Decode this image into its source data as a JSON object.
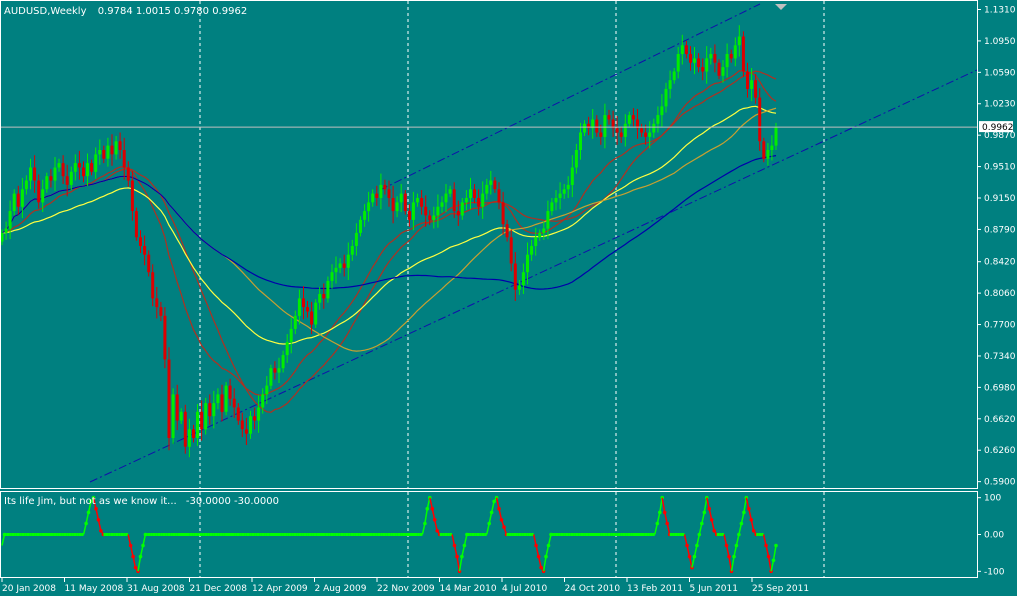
{
  "header": {
    "symbol": "AUDUSD,Weekly",
    "ohlc": "0.9784 1.0015 0.9780 0.9962"
  },
  "indicator": {
    "name": "Its life Jim, but not as we know it...",
    "values": "-30.0000 -30.0000"
  },
  "colors": {
    "background": "#008080",
    "bull": "#00ee00",
    "bear": "#dd0000",
    "ma_red": "#b03020",
    "ma_yellow": "#ffff40",
    "ma_orange": "#c8a030",
    "ma_blue": "#0000aa",
    "channel": "#1010aa",
    "grid": "#ffffff",
    "osc_up": "#00ff00",
    "osc_down": "#ff0000"
  },
  "chart_data": [
    {
      "type": "candlestick",
      "title": "AUDUSD,Weekly",
      "ylim": [
        0.585,
        1.135
      ],
      "y_ticks": [
        "1.1310",
        "1.0950",
        "1.0590",
        "1.0230",
        "0.9870",
        "0.9510",
        "0.9150",
        "0.8790",
        "0.8420",
        "0.8060",
        "0.7700",
        "0.7340",
        "0.6980",
        "0.6620",
        "0.6260",
        "0.5900"
      ],
      "x_ticks": [
        "20 Jan 2008",
        "11 May 2008",
        "31 Aug 2008",
        "21 Dec 2008",
        "12 Apr 2009",
        "2 Aug 2009",
        "22 Nov 2009",
        "14 Mar 2010",
        "4 Jul 2010",
        "24 Oct 2010",
        "13 Feb 2011",
        "5 Jun 2011",
        "25 Sep 2011"
      ],
      "current_price": "0.9962",
      "close_series": [
        0.875,
        0.88,
        0.9,
        0.92,
        0.905,
        0.925,
        0.935,
        0.95,
        0.935,
        0.91,
        0.925,
        0.94,
        0.935,
        0.95,
        0.955,
        0.94,
        0.93,
        0.945,
        0.955,
        0.95,
        0.94,
        0.955,
        0.945,
        0.965,
        0.97,
        0.96,
        0.975,
        0.965,
        0.98,
        0.97,
        0.95,
        0.935,
        0.9,
        0.87,
        0.86,
        0.85,
        0.83,
        0.8,
        0.79,
        0.78,
        0.73,
        0.64,
        0.69,
        0.66,
        0.67,
        0.63,
        0.65,
        0.64,
        0.67,
        0.65,
        0.68,
        0.665,
        0.68,
        0.69,
        0.67,
        0.7,
        0.685,
        0.675,
        0.66,
        0.65,
        0.645,
        0.665,
        0.66,
        0.675,
        0.69,
        0.7,
        0.72,
        0.715,
        0.72,
        0.735,
        0.75,
        0.765,
        0.78,
        0.8,
        0.79,
        0.785,
        0.77,
        0.795,
        0.805,
        0.8,
        0.82,
        0.83,
        0.835,
        0.84,
        0.835,
        0.85,
        0.86,
        0.875,
        0.89,
        0.9,
        0.91,
        0.92,
        0.915,
        0.93,
        0.925,
        0.915,
        0.9,
        0.91,
        0.92,
        0.9,
        0.89,
        0.91,
        0.915,
        0.905,
        0.895,
        0.89,
        0.895,
        0.905,
        0.91,
        0.92,
        0.925,
        0.9,
        0.895,
        0.91,
        0.915,
        0.925,
        0.915,
        0.905,
        0.92,
        0.93,
        0.935,
        0.925,
        0.91,
        0.885,
        0.87,
        0.84,
        0.81,
        0.815,
        0.83,
        0.85,
        0.86,
        0.87,
        0.875,
        0.88,
        0.9,
        0.91,
        0.915,
        0.92,
        0.925,
        0.93,
        0.95,
        0.97,
        0.99,
        1.0,
        0.995,
        1.005,
        0.99,
        0.985,
        1.01,
        1.005,
        0.995,
        0.99,
        0.985,
        1.0,
        1.01,
        1.005,
        0.995,
        0.99,
        0.985,
        0.99,
        1.0,
        1.01,
        1.02,
        1.04,
        1.05,
        1.06,
        1.08,
        1.09,
        1.08,
        1.07,
        1.075,
        1.065,
        1.06,
        1.075,
        1.08,
        1.07,
        1.055,
        1.065,
        1.08,
        1.075,
        1.09,
        1.1,
        1.06,
        1.04,
        1.05,
        1.03,
        0.98,
        0.96,
        0.97,
        0.975,
        0.996
      ]
    },
    {
      "type": "line",
      "title": "Its life Jim, but not as we know it...",
      "ylim": [
        -110,
        110
      ],
      "y_ticks": [
        "100",
        "0.00",
        "-100"
      ],
      "series": [
        {
          "values": [
            -30,
            0,
            0,
            0,
            0,
            0,
            0,
            0,
            0,
            0,
            0,
            0,
            0,
            0,
            0,
            0,
            0,
            0,
            0,
            0,
            0,
            0,
            0,
            0,
            0,
            0,
            0,
            0,
            0,
            0,
            0,
            0,
            0,
            0,
            30,
            60,
            90,
            100,
            70,
            40,
            10,
            0,
            0,
            0,
            0,
            0,
            0,
            0,
            0,
            0,
            0,
            0,
            -30,
            -60,
            -90,
            -100,
            -60,
            -30,
            0,
            0,
            0,
            0,
            0,
            0,
            0,
            0,
            0,
            0,
            0,
            0,
            0,
            0,
            0,
            0,
            0,
            0,
            0,
            0,
            0,
            0,
            0,
            0,
            0,
            0,
            0,
            0,
            0,
            0,
            0,
            0,
            0,
            0,
            0,
            0,
            0,
            0,
            0,
            0,
            0,
            0,
            0,
            0,
            0,
            0,
            0,
            0,
            0,
            0,
            0,
            0,
            0,
            0,
            0,
            0,
            0,
            0,
            0,
            0,
            0,
            0,
            0,
            0,
            0,
            0,
            0,
            0,
            0,
            0,
            0,
            0,
            0,
            0,
            0,
            0,
            0,
            0,
            0,
            0,
            0,
            0,
            0,
            0,
            0,
            0,
            0,
            0,
            0,
            0,
            0,
            0,
            0,
            0,
            0,
            0,
            0,
            0,
            0,
            0,
            0,
            0,
            0,
            0,
            0,
            0,
            0,
            0,
            0,
            0,
            0,
            0,
            0,
            30,
            70,
            100,
            70,
            40,
            10,
            0,
            0,
            0,
            0,
            0,
            0,
            -30,
            -60,
            -100,
            -60,
            -30,
            0,
            0,
            0,
            0,
            0,
            0,
            0,
            0,
            0,
            30,
            60,
            90,
            100,
            70,
            40,
            20,
            0,
            0,
            0,
            0,
            0,
            0,
            0,
            0,
            0,
            0,
            0,
            0,
            -30,
            -60,
            -90,
            -100,
            -60,
            -30,
            0,
            0,
            0,
            0,
            0,
            0,
            0,
            0,
            0,
            0,
            0,
            0,
            0,
            0,
            0,
            0,
            0,
            0,
            0,
            0,
            0,
            0,
            0,
            0,
            0,
            0,
            0,
            0,
            0,
            0,
            0,
            0,
            0,
            0,
            0,
            0,
            0,
            0,
            0,
            0,
            0,
            0,
            0,
            30,
            60,
            100,
            60,
            30,
            0,
            0,
            0,
            0,
            0,
            0,
            0,
            -30,
            -60,
            -90,
            -60,
            -30,
            0,
            30,
            60,
            100,
            70,
            40,
            10,
            0,
            0,
            0,
            0,
            -30,
            -60,
            -100,
            -60,
            -30,
            0,
            30,
            60,
            100,
            70,
            40,
            10,
            0,
            0,
            0,
            0,
            -30,
            -60,
            -100,
            -70,
            -30
          ]
        }
      ]
    }
  ]
}
